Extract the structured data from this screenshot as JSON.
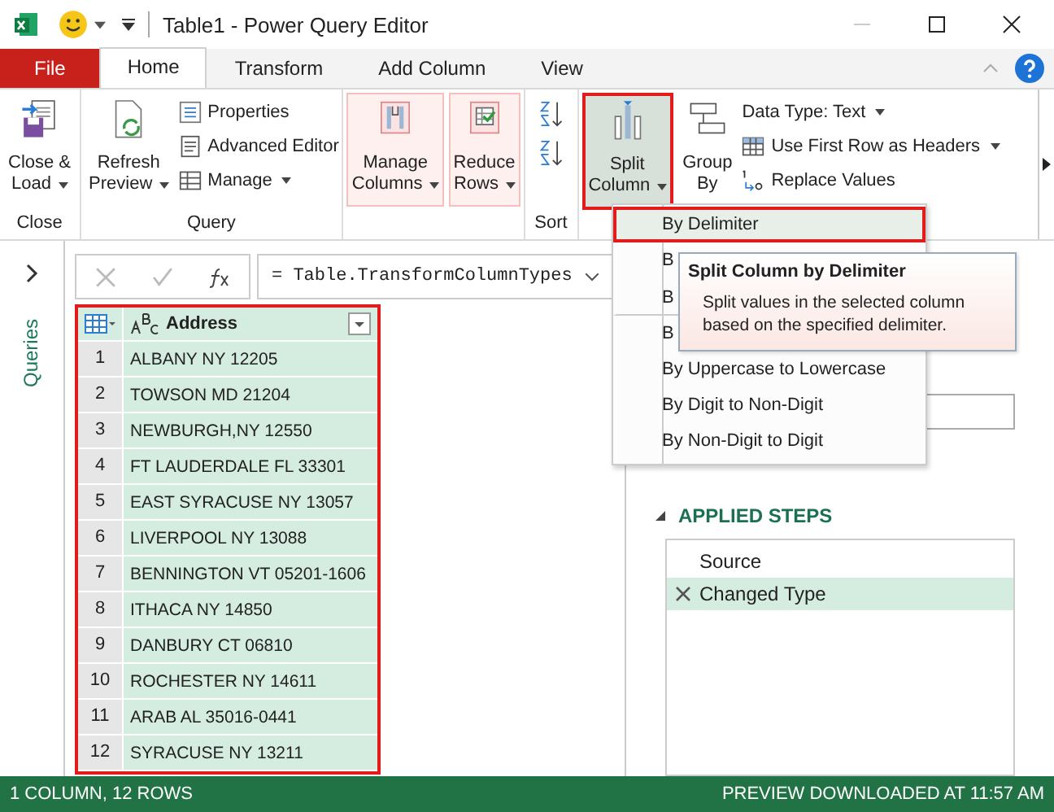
{
  "window": {
    "title": "Table1 - Power Query Editor"
  },
  "tabs": [
    {
      "label": "File",
      "kind": "file",
      "selected": false
    },
    {
      "label": "Home",
      "kind": "tab",
      "selected": true
    },
    {
      "label": "Transform",
      "kind": "tab",
      "selected": false
    },
    {
      "label": "Add Column",
      "kind": "tab",
      "selected": false
    },
    {
      "label": "View",
      "kind": "tab",
      "selected": false
    }
  ],
  "ribbon": {
    "close_group": {
      "label": "Close",
      "button": [
        "Close &",
        "Load"
      ]
    },
    "query_group": {
      "label": "Query",
      "refresh": [
        "Refresh",
        "Preview"
      ],
      "properties": "Properties",
      "advanced_editor": "Advanced Editor",
      "manage": "Manage"
    },
    "manage_columns": [
      "Manage",
      "Columns"
    ],
    "reduce_rows": [
      "Reduce",
      "Rows"
    ],
    "sort_group": {
      "label": "Sort"
    },
    "split_column": {
      "label": [
        "Split",
        "Column"
      ],
      "highlighted": true
    },
    "group_by": [
      "Group",
      "By"
    ],
    "data_type": "Data Type: Text",
    "use_first_row": "Use First Row as Headers",
    "replace_values": "Replace Values"
  },
  "queries_pane": {
    "label": "Queries"
  },
  "formula": "= Table.TransformColumnTypes",
  "table": {
    "highlighted": true,
    "column": "Address",
    "rows": [
      {
        "index": "1",
        "value": "ALBANY NY 12205"
      },
      {
        "index": "2",
        "value": "TOWSON MD 21204"
      },
      {
        "index": "3",
        "value": "NEWBURGH,NY 12550"
      },
      {
        "index": "4",
        "value": "FT LAUDERDALE FL 33301"
      },
      {
        "index": "5",
        "value": "EAST SYRACUSE NY 13057"
      },
      {
        "index": "6",
        "value": "LIVERPOOL NY 13088"
      },
      {
        "index": "7",
        "value": "BENNINGTON VT 05201-1606"
      },
      {
        "index": "8",
        "value": "ITHACA NY 14850"
      },
      {
        "index": "9",
        "value": "DANBURY CT 06810"
      },
      {
        "index": "10",
        "value": "ROCHESTER NY 14611"
      },
      {
        "index": "11",
        "value": "ARAB AL 35016-0441"
      },
      {
        "index": "12",
        "value": "SYRACUSE NY 13211"
      }
    ]
  },
  "split_menu": {
    "items": [
      {
        "label": "By Delimiter",
        "selected": true,
        "highlighted": true,
        "separator_after": false
      },
      {
        "label": "B",
        "selected": false,
        "highlighted": false,
        "separator_after": false
      },
      {
        "label": "B",
        "selected": false,
        "highlighted": false,
        "separator_after": true
      },
      {
        "label": "B",
        "selected": false,
        "highlighted": false,
        "separator_after": false
      },
      {
        "label": "By Uppercase to Lowercase",
        "selected": false,
        "highlighted": false,
        "separator_after": false
      },
      {
        "label": "By Digit to Non-Digit",
        "selected": false,
        "highlighted": false,
        "separator_after": false
      },
      {
        "label": "By Non-Digit to Digit",
        "selected": false,
        "highlighted": false,
        "separator_after": false
      }
    ]
  },
  "tooltip": {
    "title": "Split Column by Delimiter",
    "text": "Split values in the selected column based on the specified delimiter."
  },
  "applied_steps": {
    "title": "APPLIED STEPS",
    "steps": [
      {
        "label": "Source",
        "selected": false,
        "deletable": false
      },
      {
        "label": "Changed Type",
        "selected": true,
        "deletable": true
      }
    ]
  },
  "status_bar": {
    "left": "1 COLUMN, 12 ROWS",
    "right": "PREVIEW DOWNLOADED AT 11:57 AM"
  }
}
